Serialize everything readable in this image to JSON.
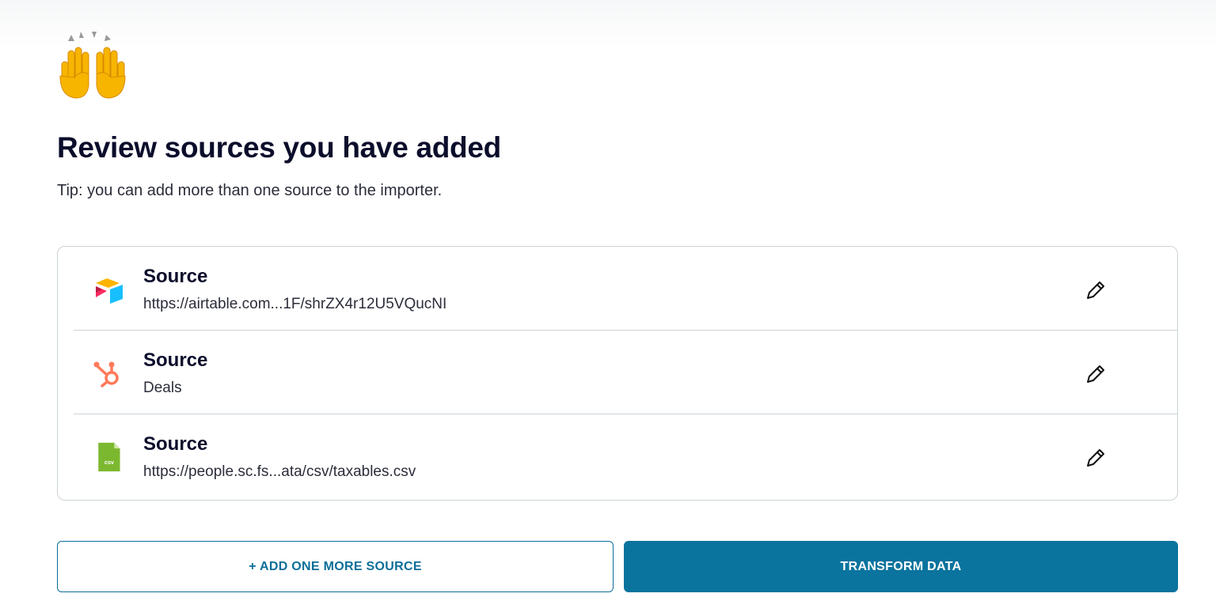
{
  "page": {
    "title": "Review sources you have added",
    "tip": "Tip: you can add more than one source to the importer."
  },
  "sources": [
    {
      "title": "Source",
      "detail": "https://airtable.com...1F/shrZX4r12U5VQucNI",
      "icon": "airtable-logo-icon"
    },
    {
      "title": "Source",
      "detail": "Deals",
      "icon": "hubspot-logo-icon"
    },
    {
      "title": "Source",
      "detail": "https://people.sc.fs...ata/csv/taxables.csv",
      "icon": "csv-file-icon",
      "icon_text": "csv"
    }
  ],
  "actions": {
    "add_label": "+ ADD ONE MORE SOURCE",
    "transform_label": "TRANSFORM DATA"
  },
  "colors": {
    "primary": "#0a739e",
    "heading": "#0b0d2b",
    "border": "#cdd3d8",
    "hubspot": "#ff7a59",
    "csv": "#7cb82f"
  }
}
